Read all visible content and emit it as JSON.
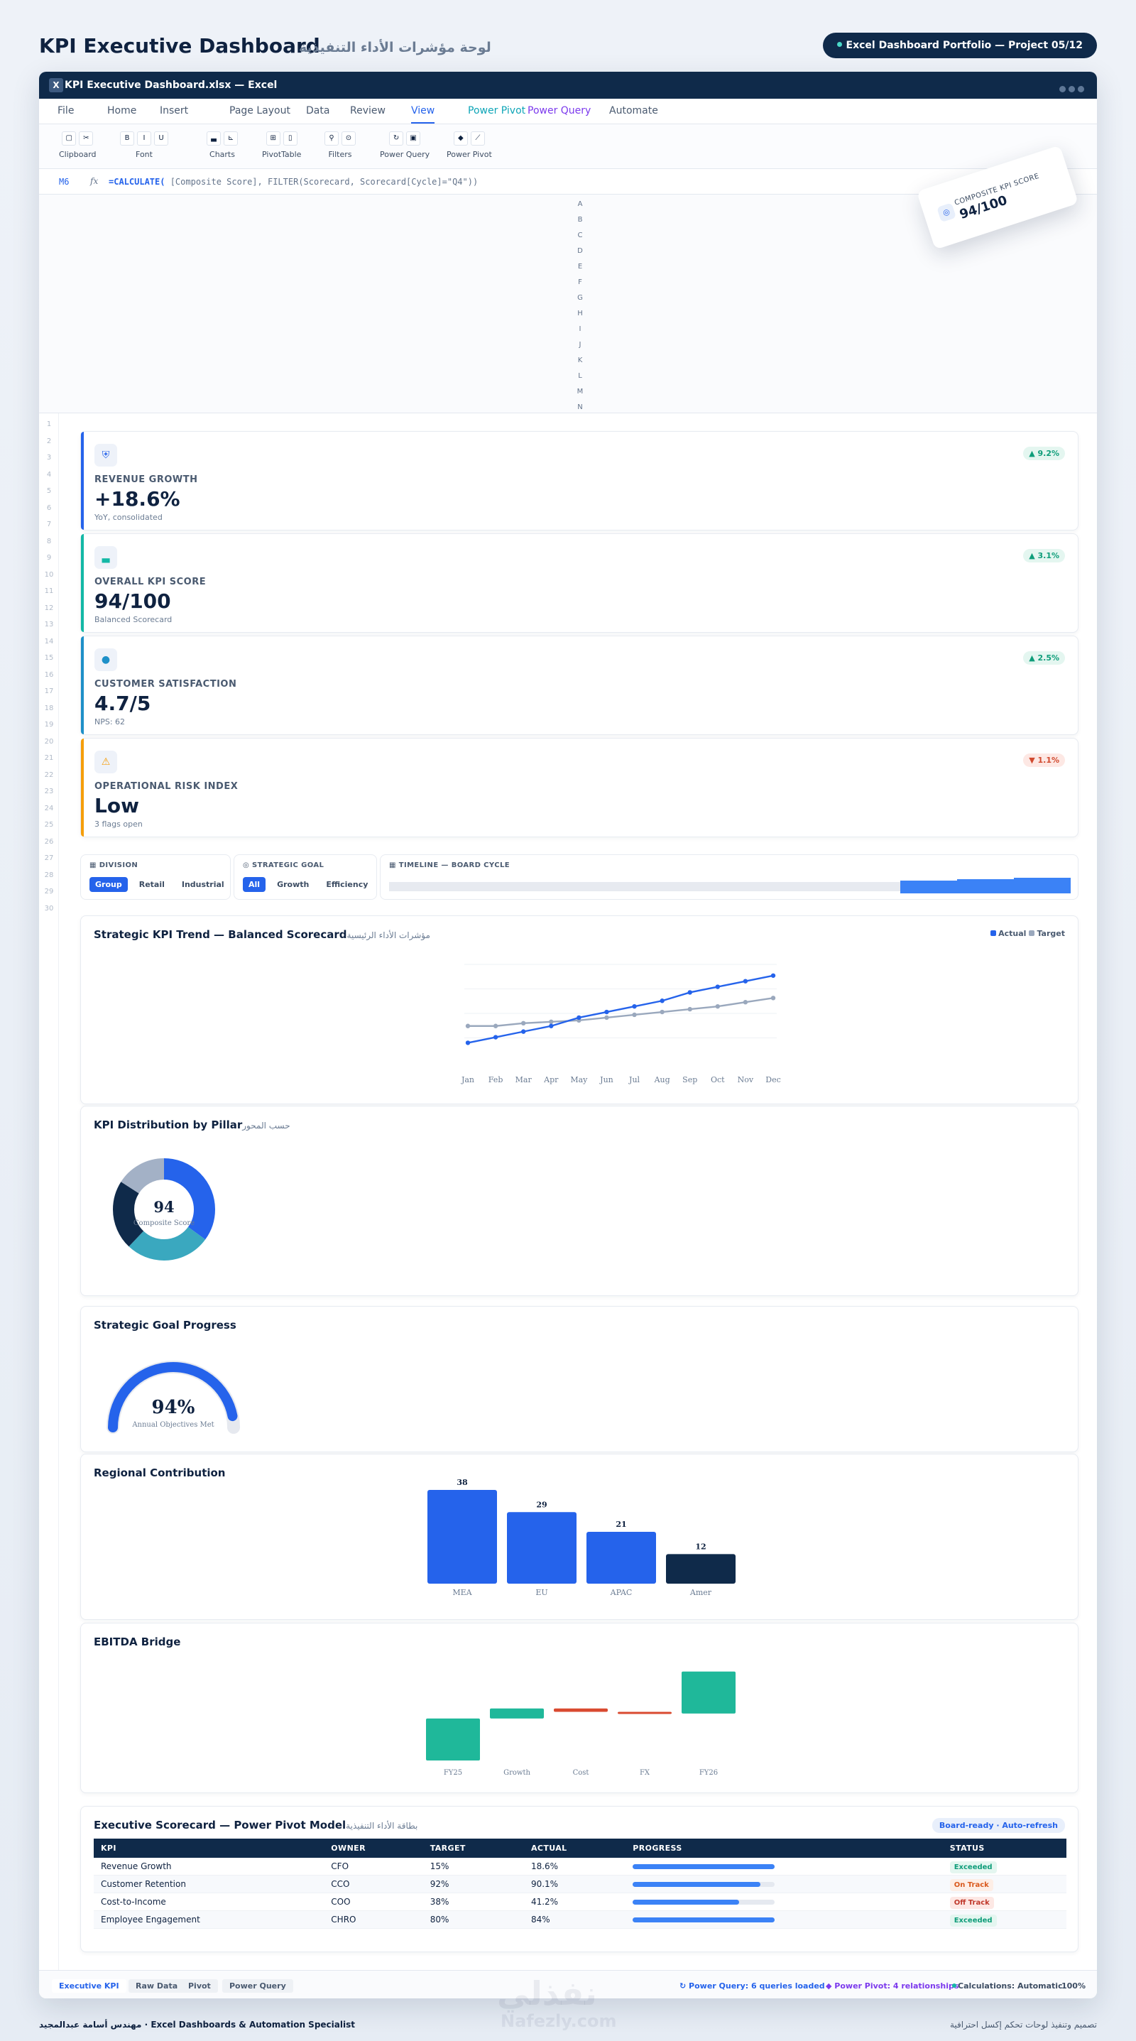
{
  "header": {
    "title": "KPI Executive Dashboard",
    "title_ar": "لوحة مؤشرات الأداء التنفيذية",
    "pill": "Excel Dashboard Portfolio — Project 05/12"
  },
  "window": {
    "title": "KPI Executive Dashboard.xlsx — Excel",
    "icon": "X"
  },
  "menu": [
    "File",
    "Home",
    "Insert",
    "Page Layout",
    "Data",
    "Review",
    "View",
    "Power Pivot",
    "Power Query",
    "Automate"
  ],
  "ribbon": [
    {
      "label": "Clipboard",
      "btns": [
        "▢",
        "✂"
      ]
    },
    {
      "label": "Font",
      "btns": [
        "B",
        "I",
        "U"
      ]
    },
    {
      "label": "Charts",
      "btns": [
        "▃",
        "⊾"
      ]
    },
    {
      "label": "PivotTable",
      "btns": [
        "⊞",
        "▯"
      ]
    },
    {
      "label": "Filters",
      "btns": [
        "⚲",
        "⊙"
      ]
    },
    {
      "label": "Power Query",
      "btns": [
        "↻",
        "▣"
      ]
    },
    {
      "label": "Power Pivot",
      "btns": [
        "◆",
        "⟋"
      ]
    }
  ],
  "formula": {
    "cell": "M6",
    "fx": "fx",
    "fn": "=CALCULATE(",
    "rest": " [Composite Score], FILTER(Scorecard, Scorecard[Cycle]=\"Q4\"))"
  },
  "columns": [
    "A",
    "B",
    "C",
    "D",
    "E",
    "F",
    "G",
    "H",
    "I",
    "J",
    "K",
    "L",
    "M",
    "N"
  ],
  "rows": [
    "1",
    "2",
    "3",
    "4",
    "5",
    "6",
    "7",
    "8",
    "9",
    "10",
    "11",
    "12",
    "13",
    "14",
    "15",
    "16",
    "17",
    "18",
    "19",
    "20",
    "21",
    "22",
    "23",
    "24",
    "25",
    "26",
    "27",
    "28",
    "29",
    "30"
  ],
  "float_card": {
    "label": "COMPOSITE KPI SCORE",
    "value": "94/100"
  },
  "kpis": [
    {
      "label": "REVENUE GROWTH",
      "value": "+18.6%",
      "sub": "YoY, consolidated",
      "delta": "▲ 9.2%",
      "dir": "up",
      "color": "#2563eb",
      "icon": "⛨"
    },
    {
      "label": "OVERALL KPI SCORE",
      "value": "94/100",
      "sub": "Balanced Scorecard",
      "delta": "▲ 3.1%",
      "dir": "up",
      "color": "#14b8a6",
      "icon": "▃"
    },
    {
      "label": "CUSTOMER SATISFACTION",
      "value": "4.7/5",
      "sub": "NPS: 62",
      "delta": "▲ 2.5%",
      "dir": "up",
      "color": "#1e90c8",
      "icon": "●"
    },
    {
      "label": "OPERATIONAL RISK INDEX",
      "value": "Low",
      "sub": "3 flags open",
      "delta": "▼ 1.1%",
      "dir": "down",
      "color": "#f59e0b",
      "icon": "⚠"
    }
  ],
  "slicers": {
    "division": {
      "title": "▦ DIVISION",
      "options": [
        "Group",
        "Retail",
        "Industrial"
      ],
      "active": 0
    },
    "goal": {
      "title": "◎ STRATEGIC GOAL",
      "options": [
        "All",
        "Growth",
        "Efficiency"
      ],
      "active": 0
    },
    "timeline": {
      "title": "▦ TIMELINE — BOARD CYCLE"
    }
  },
  "trend": {
    "title": "Strategic KPI Trend — Balanced Scorecard",
    "title_ar": "مؤشرات الأداء الرئيسية",
    "legend": [
      "Actual",
      "Target"
    ]
  },
  "distribution": {
    "title": "KPI Distribution by Pillar",
    "title_ar": "حسب المحور"
  },
  "goal": {
    "title": "Strategic Goal Progress"
  },
  "regional": {
    "title": "Regional Contribution"
  },
  "ebitda": {
    "title": "EBITDA Bridge"
  },
  "chart_data": [
    {
      "type": "line",
      "categories": [
        "Jan",
        "Feb",
        "Mar",
        "Apr",
        "May",
        "Jun",
        "Jul",
        "Aug",
        "Sep",
        "Oct",
        "Nov",
        "Dec"
      ],
      "series": [
        {
          "name": "Actual",
          "values": [
            72,
            74,
            76,
            78,
            81,
            83,
            85,
            87,
            90,
            92,
            94,
            96
          ]
        },
        {
          "name": "Target",
          "values": [
            78,
            78,
            79,
            79.5,
            80,
            81,
            82,
            83,
            84,
            85,
            86.5,
            88
          ]
        }
      ],
      "ylim": [
        65,
        100
      ],
      "colors": [
        "#2563eb",
        "#9aa8bd"
      ]
    },
    {
      "type": "pie",
      "slices": [
        {
          "value": 35,
          "color": "#2563eb"
        },
        {
          "value": 27,
          "color": "#3aa8bf"
        },
        {
          "value": 22,
          "color": "#0f2a4a"
        },
        {
          "value": 16,
          "color": "#a3b1c6"
        }
      ],
      "center_value": "94",
      "center_label": "Composite Score"
    },
    {
      "type": "gauge",
      "value": 94,
      "center_value": "94%",
      "label": "Annual Objectives Met"
    },
    {
      "type": "bar",
      "categories": [
        "MEA",
        "EU",
        "APAC",
        "Amer"
      ],
      "values": [
        38,
        29,
        21,
        12
      ],
      "labels": [
        "38",
        "29",
        "21",
        "12"
      ],
      "ylim": [
        0,
        38
      ],
      "colors": [
        "#2563eb",
        "#2563eb",
        "#2563eb",
        "#0f2a4a"
      ]
    },
    {
      "type": "waterfall",
      "categories": [
        "FY25",
        "Growth",
        "Cost",
        "FX",
        "FY26"
      ],
      "steps": [
        {
          "base": 0,
          "end": 50,
          "color": "#1fb89a"
        },
        {
          "base": 50,
          "end": 62,
          "color": "#1fb89a"
        },
        {
          "base": 62,
          "end": 58,
          "color": "#d94a30"
        },
        {
          "base": 58,
          "end": 56,
          "color": "#d94a30"
        },
        {
          "base": 56,
          "end": 106,
          "color": "#1fb89a"
        }
      ],
      "ylim": [
        0,
        110
      ]
    }
  ],
  "scorecard": {
    "title": "Executive Scorecard — Power Pivot Model",
    "title_ar": "بطاقة الأداء التنفيذية",
    "badge": "Board-ready · Auto-refresh",
    "headers": [
      "KPI",
      "OWNER",
      "TARGET",
      "ACTUAL",
      "PROGRESS",
      "STATUS"
    ],
    "rows": [
      {
        "kpi": "Revenue Growth",
        "owner": "CFO",
        "target": "15%",
        "actual": "18.6%",
        "progress": 1.0,
        "status": "Exceeded",
        "cls": "ex"
      },
      {
        "kpi": "Customer Retention",
        "owner": "CCO",
        "target": "92%",
        "actual": "90.1%",
        "progress": 0.9,
        "status": "On Track",
        "cls": "on"
      },
      {
        "kpi": "Cost-to-Income",
        "owner": "COO",
        "target": "38%",
        "actual": "41.2%",
        "progress": 0.75,
        "status": "Off Track",
        "cls": "off"
      },
      {
        "kpi": "Employee Engagement",
        "owner": "CHRO",
        "target": "80%",
        "actual": "84%",
        "progress": 1.0,
        "status": "Exceeded",
        "cls": "ex"
      }
    ]
  },
  "sheets": [
    "Executive KPI",
    "Raw Data",
    "Pivot",
    "Power Query"
  ],
  "status": {
    "pq": "↻ Power Query: 6 queries loaded",
    "pp": "◆ Power Pivot: 4 relationships",
    "calc": "Calculations: Automatic",
    "zoom": "100%"
  },
  "footer": {
    "left": "مهندس أسامة عبدالمجيد  ·  Excel Dashboards & Automation Specialist",
    "right": "تصميم وتنفيذ لوحات تحكم إكسل احترافية"
  },
  "watermark": {
    "ar": "نفذلي",
    "en": "Nafezly.com"
  }
}
